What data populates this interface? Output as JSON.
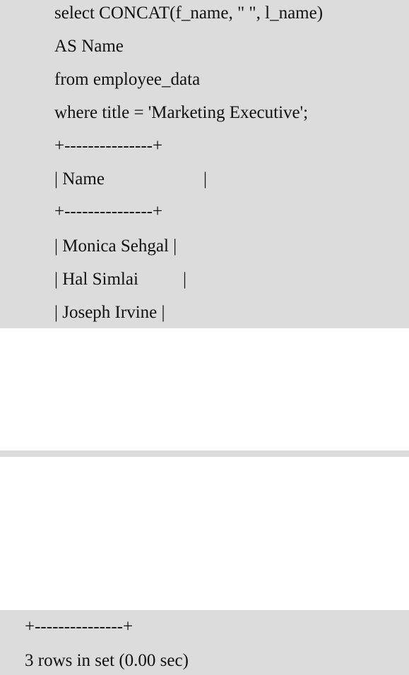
{
  "query": {
    "lines": [
      "select CONCAT(f_name, \" \", l_name)",
      "AS Name",
      "from employee_data",
      "where title = 'Marketing Executive';"
    ]
  },
  "result": {
    "border": "+---------------+",
    "header": "| Name",
    "header_end": "|",
    "rows": [
      "| Monica Sehgal |",
      "| Hal Simlai",
      "| Joseph Irvine |"
    ],
    "row_end": "|",
    "footer_border": "+---------------+",
    "summary": "3 rows in set (0.00 sec)"
  }
}
